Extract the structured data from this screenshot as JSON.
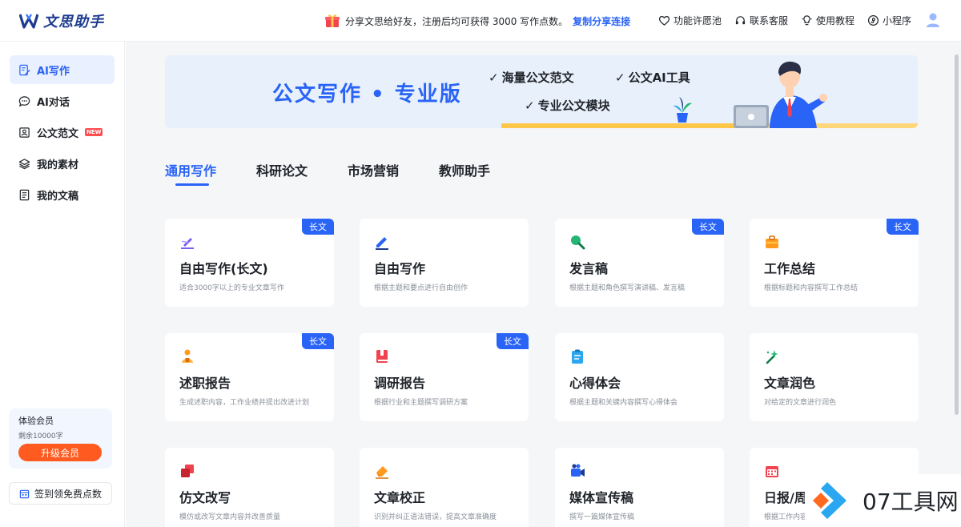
{
  "header": {
    "logo_text": "文思助手",
    "share_text": "分享文思给好友，注册后均可获得 3000 写作点数。",
    "share_link": "复制分享连接",
    "nav": [
      {
        "label": "功能许愿池",
        "icon": "heart-icon"
      },
      {
        "label": "联系客服",
        "icon": "headset-icon"
      },
      {
        "label": "使用教程",
        "icon": "lightbulb-icon"
      },
      {
        "label": "小程序",
        "icon": "miniprogram-icon"
      }
    ]
  },
  "sidebar": {
    "items": [
      {
        "label": "AI写作",
        "icon": "edit-doc-icon",
        "active": true
      },
      {
        "label": "AI对话",
        "icon": "chat-icon"
      },
      {
        "label": "公文范文",
        "icon": "template-icon",
        "badge": "NEW"
      },
      {
        "label": "我的素材",
        "icon": "layers-icon"
      },
      {
        "label": "我的文稿",
        "icon": "document-icon"
      }
    ],
    "member": {
      "title": "体验会员",
      "remaining": "剩余10000字",
      "upgrade": "升级会员"
    },
    "signin": "签到领免费点数"
  },
  "banner": {
    "title": "公文写作 • 专业版",
    "features": [
      "海量公文范文",
      "公文AI工具",
      "专业公文模块"
    ]
  },
  "tabs": [
    "通用写作",
    "科研论文",
    "市场营销",
    "教师助手"
  ],
  "cards": [
    {
      "title": "自由写作(长文)",
      "desc": "适合3000字以上的专业文章写作",
      "tag": "长文",
      "icon": "pen-icon",
      "color": "#7b5cf0"
    },
    {
      "title": "自由写作",
      "desc": "根据主题和要点进行自由创作",
      "tag": "",
      "icon": "pencil-icon",
      "color": "#2a64f6"
    },
    {
      "title": "发言稿",
      "desc": "根据主题和角色撰写演讲稿、发言稿",
      "tag": "长文",
      "icon": "magnifier-icon",
      "color": "#22b573"
    },
    {
      "title": "工作总结",
      "desc": "根据标题和内容撰写工作总结",
      "tag": "长文",
      "icon": "briefcase-icon",
      "color": "#ff9a1f"
    },
    {
      "title": "述职报告",
      "desc": "生成述职内容，工作业绩并提出改进计划",
      "tag": "长文",
      "icon": "people-icon",
      "color": "#ff9a1f"
    },
    {
      "title": "调研报告",
      "desc": "根据行业和主题撰写调研方案",
      "tag": "长文",
      "icon": "book-icon",
      "color": "#f0434f"
    },
    {
      "title": "心得体会",
      "desc": "根据主题和关键内容撰写心得体会",
      "tag": "",
      "icon": "clipboard-icon",
      "color": "#2aa7f0"
    },
    {
      "title": "文章润色",
      "desc": "对给定的文章进行润色",
      "tag": "",
      "icon": "magic-wand-icon",
      "color": "#22b573"
    },
    {
      "title": "仿文改写",
      "desc": "模仿或改写文章内容并改善质量",
      "tag": "",
      "icon": "copy-icon",
      "color": "#f0434f"
    },
    {
      "title": "文章校正",
      "desc": "识别并纠正语法错误，提高文章准确度",
      "tag": "",
      "icon": "eraser-icon",
      "color": "#ff9a1f"
    },
    {
      "title": "媒体宣传稿",
      "desc": "撰写一篇媒体宣传稿",
      "tag": "",
      "icon": "camera-icon",
      "color": "#2a64f6"
    },
    {
      "title": "日报/周报",
      "desc": "根据工作内容撰写日报周报",
      "tag": "",
      "icon": "calendar-icon",
      "color": "#f0434f"
    }
  ],
  "watermark": {
    "text": "07工具网"
  }
}
